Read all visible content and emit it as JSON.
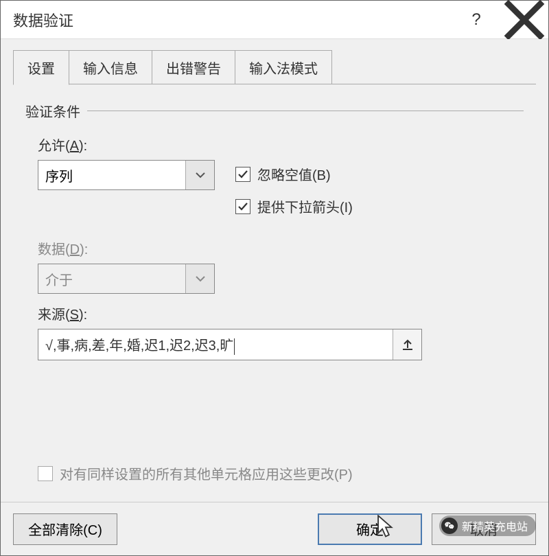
{
  "titlebar": {
    "title": "数据验证",
    "help_tooltip": "?",
    "close_tooltip": "×"
  },
  "tabs": {
    "settings": "设置",
    "input_msg": "输入信息",
    "error_alert": "出错警告",
    "ime_mode": "输入法模式"
  },
  "panel": {
    "criteria_label": "验证条件",
    "allow_label_pre": "允许(",
    "allow_label_key": "A",
    "allow_label_post": "):",
    "allow_value": "序列",
    "data_label_pre": "数据(",
    "data_label_key": "D",
    "data_label_post": "):",
    "data_value": "介于",
    "source_label_pre": "来源(",
    "source_label_key": "S",
    "source_label_post": "):",
    "source_value": "√,事,病,差,年,婚,迟1,迟2,迟3,旷",
    "cb_ignore_blank_pre": "忽略空值(",
    "cb_ignore_blank_key": "B",
    "cb_ignore_blank_post": ")",
    "cb_dropdown_pre": "提供下拉箭头(",
    "cb_dropdown_key": "I",
    "cb_dropdown_post": ")",
    "apply_all_pre": "对有同样设置的所有其他单元格应用这些更改(",
    "apply_all_key": "P",
    "apply_all_post": ")"
  },
  "buttons": {
    "clear_all_pre": "全部清除(",
    "clear_all_key": "C",
    "clear_all_post": ")",
    "ok": "确定",
    "cancel": "取消"
  },
  "watermark": {
    "text": "新精英充电站"
  }
}
